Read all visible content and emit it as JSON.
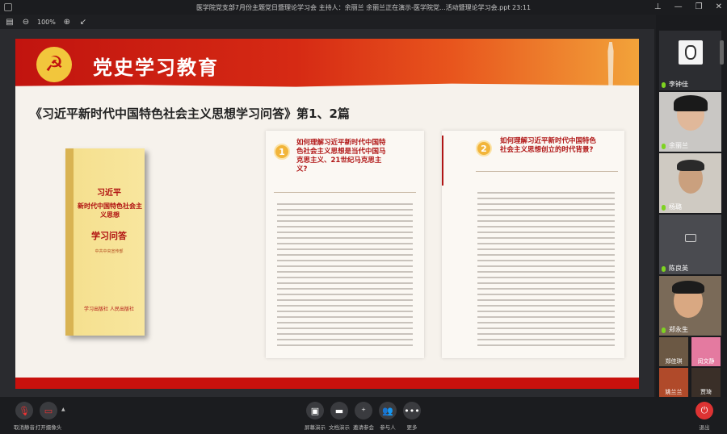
{
  "window": {
    "title": "医学院党支部7月份主题党日暨理论学习会  主持人：余丽兰  余丽兰正在演示-医学院党...活动暨理论学习会.ppt  23:11"
  },
  "toolbar": {
    "zoom": "100%"
  },
  "slide": {
    "banner_title": "党史学习教育",
    "heading": "《习近平新时代中国特色社会主义思想学习问答》第1、2篇",
    "book": {
      "title_line1": "习近平",
      "title_line2": "新时代中国特色社会主义思想",
      "title_line3": "学习问答",
      "publisher_top": "中共中央宣传部",
      "publisher_bottom": "学习出版社 人民出版社"
    },
    "q1": {
      "number": "1",
      "text": "如何理解习近平新时代中国特色社会主义思想是当代中国马克思主义、21世纪马克思主义?"
    },
    "q2": {
      "number": "2",
      "text": "如何理解习近平新时代中国特色社会主义思想创立的时代背景?"
    }
  },
  "participants": [
    {
      "name": "李钟佳"
    },
    {
      "name": "余丽兰"
    },
    {
      "name": "杨璐"
    },
    {
      "name": "陈良英"
    },
    {
      "name": "郑永生"
    }
  ],
  "small_participants": [
    {
      "name": "郑佳琪"
    },
    {
      "name": "闵文静"
    },
    {
      "name": "姚兰兰"
    },
    {
      "name": "贾琦"
    }
  ],
  "controls": {
    "mute": "取消静音",
    "camera": "打开摄像头",
    "share": "屏幕演示",
    "doc": "文档演示",
    "invite": "邀请参会",
    "members": "参与人",
    "more": "更多",
    "exit": "退出"
  }
}
